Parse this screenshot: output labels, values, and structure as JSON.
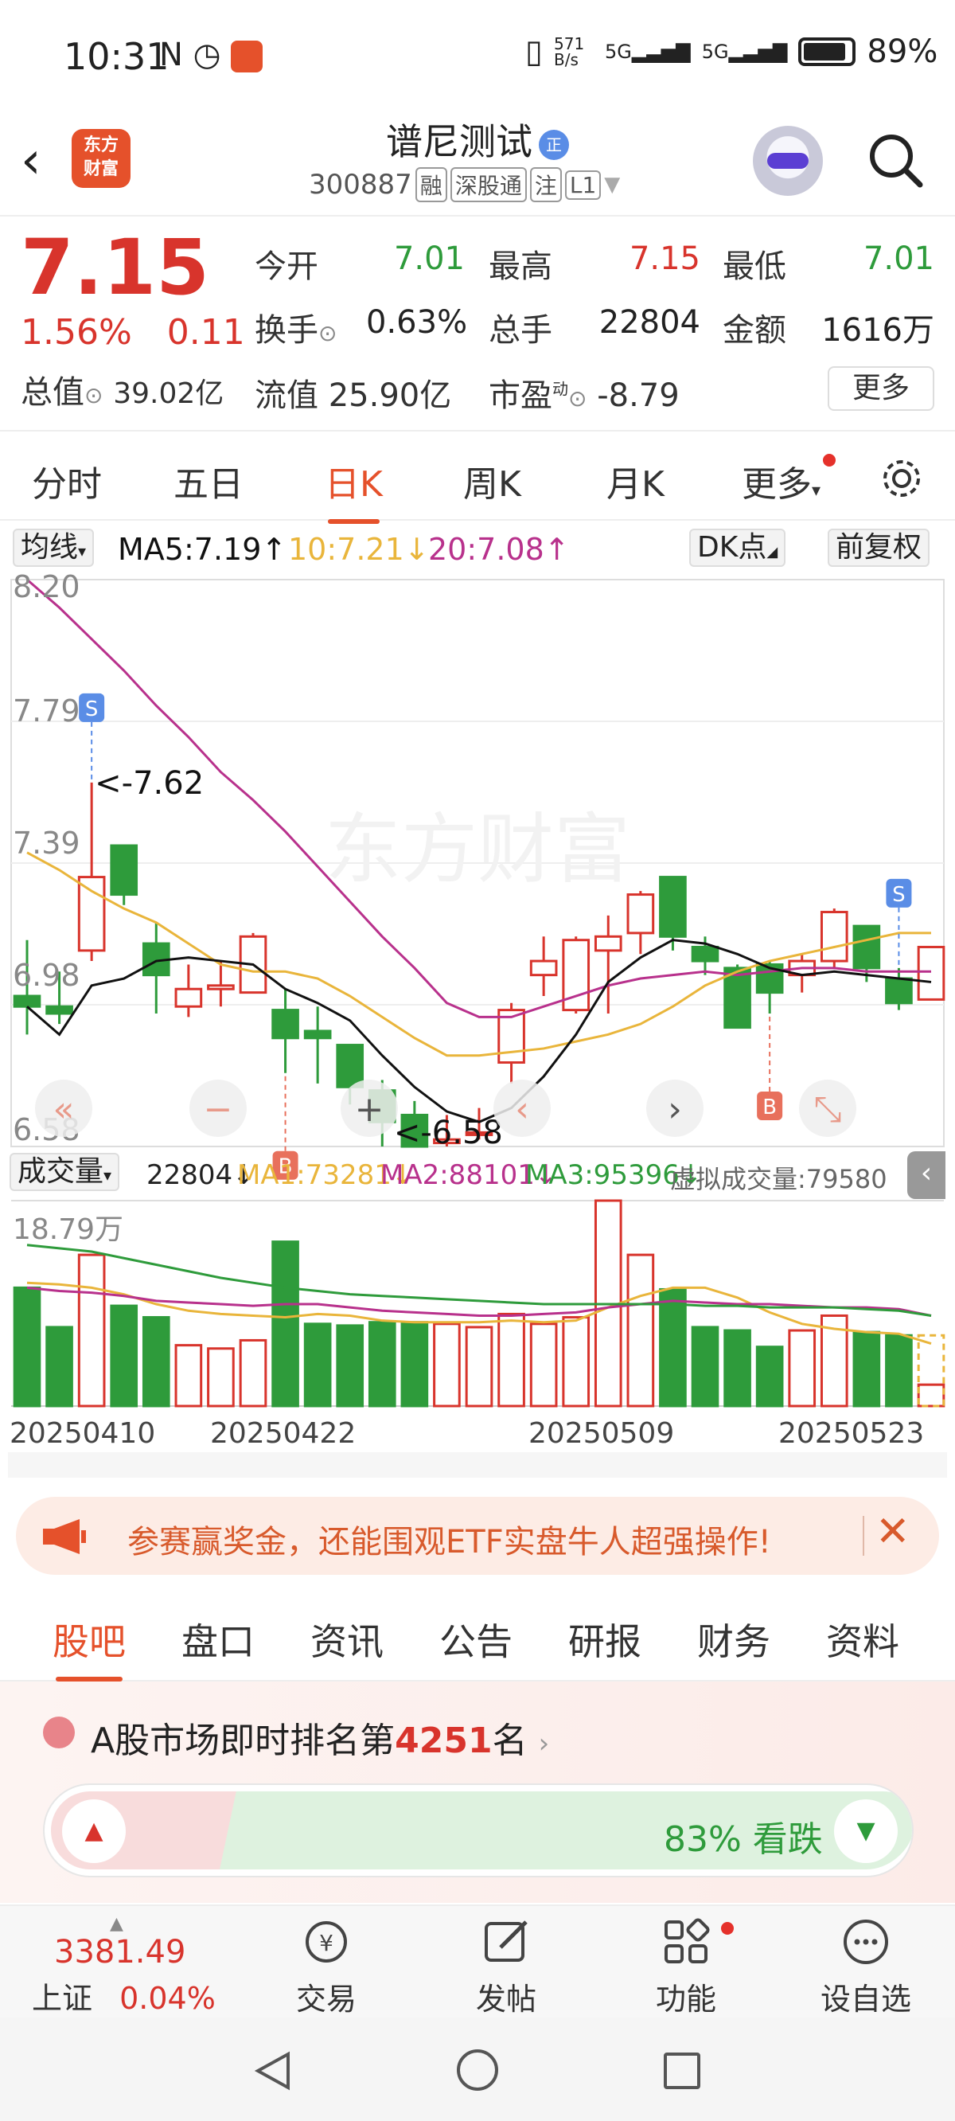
{
  "status_bar": {
    "time": "10:31",
    "speed": "571\nB/s",
    "net1": "5G",
    "net2": "5G",
    "battery": "89%"
  },
  "header": {
    "logo_text": "东方财富",
    "stock_name": "谱尼测试",
    "badge": "正",
    "code": "300887",
    "tags": [
      "融",
      "深股通",
      "注",
      "L1"
    ]
  },
  "quote": {
    "price": "7.15",
    "change_pct": "1.56%",
    "change_abs": "0.11",
    "market_cap_label": "总值",
    "market_cap": "39.02亿",
    "open_label": "今开",
    "open": "7.01",
    "high_label": "最高",
    "high": "7.15",
    "low_label": "最低",
    "low": "7.01",
    "turnover_label": "换手",
    "turnover": "0.63%",
    "volume_label": "总手",
    "volume": "22804",
    "amount_label": "金额",
    "amount": "1616万",
    "float_label": "流值",
    "float_cap": "25.90亿",
    "pe_label": "市盈",
    "pe_sup": "动",
    "pe": "-8.79",
    "more": "更多"
  },
  "tabs": [
    "分时",
    "五日",
    "日K",
    "周K",
    "月K",
    "更多"
  ],
  "active_tab": "日K",
  "ma_bar": {
    "indicator": "均线",
    "ma5": "MA5:7.19↑",
    "ma10": "10:7.21↓",
    "ma20": "20:7.08↑",
    "dk": "DK点",
    "adjust": "前复权"
  },
  "colors": {
    "up": "#d8342c",
    "down": "#2e9b3b",
    "ma5": "#111111",
    "ma10": "#e9b53b",
    "ma20": "#b8318c",
    "accent": "#e5512b"
  },
  "kline": {
    "y_ticks": [
      "8.20",
      "7.79",
      "7.39",
      "6.98",
      "6.58"
    ],
    "high_annot": "<-7.62",
    "low_annot": "<-6.58",
    "markers": {
      "sell": "S",
      "buy": "B"
    },
    "candles": [
      [
        7.01,
        6.98,
        7.17,
        6.9
      ],
      [
        6.98,
        6.96,
        7.08,
        6.93
      ],
      [
        7.14,
        7.35,
        7.62,
        7.11
      ],
      [
        7.44,
        7.3,
        7.44,
        7.27
      ],
      [
        7.16,
        7.07,
        7.22,
        6.96
      ],
      [
        6.98,
        7.03,
        7.1,
        6.95
      ],
      [
        7.03,
        7.04,
        7.11,
        6.98
      ],
      [
        7.02,
        7.18,
        7.19,
        7.02
      ],
      [
        6.97,
        6.89,
        7.03,
        6.79
      ],
      [
        6.91,
        6.89,
        6.98,
        6.76
      ],
      [
        6.87,
        6.75,
        6.87,
        6.7
      ],
      [
        6.74,
        6.65,
        6.77,
        6.58
      ],
      [
        6.67,
        6.58,
        6.71,
        6.58
      ],
      [
        6.59,
        6.6,
        6.67,
        6.58
      ],
      [
        6.62,
        6.62,
        6.69,
        6.6
      ],
      [
        6.82,
        6.97,
        6.99,
        6.76
      ],
      [
        7.07,
        7.11,
        7.18,
        7.01
      ],
      [
        6.97,
        7.17,
        7.18,
        6.96
      ],
      [
        7.14,
        7.18,
        7.24,
        6.96
      ],
      [
        7.19,
        7.3,
        7.31,
        7.13
      ],
      [
        7.35,
        7.18,
        7.35,
        7.14
      ],
      [
        7.15,
        7.11,
        7.18,
        7.07
      ],
      [
        7.09,
        6.92,
        7.1,
        7.01
      ],
      [
        7.1,
        7.02,
        7.11,
        6.96
      ],
      [
        7.07,
        7.11,
        7.13,
        7.02
      ],
      [
        7.11,
        7.25,
        7.26,
        7.09
      ],
      [
        7.21,
        7.09,
        7.21,
        7.05
      ],
      [
        7.06,
        6.99,
        7.09,
        6.97
      ],
      [
        7.0,
        7.15,
        7.15,
        7.0
      ]
    ],
    "ma5": [
      6.98,
      6.9,
      7.04,
      7.06,
      7.11,
      7.12,
      7.11,
      7.1,
      7.03,
      6.99,
      6.94,
      6.84,
      6.75,
      6.68,
      6.65,
      6.69,
      6.78,
      6.9,
      7.05,
      7.12,
      7.17,
      7.16,
      7.13,
      7.09,
      7.07,
      7.08,
      7.07,
      7.06,
      7.05
    ],
    "ma10": [
      7.42,
      7.37,
      7.31,
      7.26,
      7.22,
      7.16,
      7.1,
      7.08,
      7.08,
      7.06,
      7.01,
      6.95,
      6.89,
      6.84,
      6.84,
      6.85,
      6.86,
      6.88,
      6.9,
      6.93,
      6.98,
      7.04,
      7.08,
      7.11,
      7.13,
      7.15,
      7.17,
      7.19,
      7.19
    ],
    "ma20": [
      8.2,
      8.12,
      8.03,
      7.94,
      7.84,
      7.75,
      7.65,
      7.57,
      7.48,
      7.38,
      7.28,
      7.18,
      7.09,
      6.99,
      6.95,
      6.95,
      6.98,
      7.01,
      7.04,
      7.06,
      7.07,
      7.08,
      7.07,
      7.08,
      7.09,
      7.09,
      7.08,
      7.08,
      7.08
    ],
    "sell_idx": [
      2,
      27
    ],
    "buy_idx": [
      8,
      23
    ]
  },
  "volume_bar": {
    "label": "成交量",
    "value": "22804↓",
    "ma1": "MA1:73281↓",
    "ma2": "MA2:88101↓",
    "ma3": "MA3:95396↓",
    "virtual": "虚拟成交量:79580",
    "max_label": "18.79万",
    "volumes": [
      0.72,
      0.48,
      0.92,
      0.61,
      0.54,
      0.37,
      0.35,
      0.4,
      1.0,
      0.5,
      0.49,
      0.51,
      0.51,
      0.5,
      0.48,
      0.56,
      0.5,
      0.54,
      1.25,
      0.92,
      0.71,
      0.48,
      0.46,
      0.36,
      0.46,
      0.55,
      0.45,
      0.43,
      0.13
    ],
    "virtual_volume": 0.43,
    "vma1": [
      0.75,
      0.74,
      0.72,
      0.68,
      0.62,
      0.58,
      0.56,
      0.55,
      0.54,
      0.56,
      0.55,
      0.52,
      0.51,
      0.51,
      0.51,
      0.52,
      0.51,
      0.52,
      0.6,
      0.67,
      0.72,
      0.72,
      0.66,
      0.57,
      0.5,
      0.47,
      0.45,
      0.44,
      0.38
    ],
    "vma2": [
      0.72,
      0.7,
      0.69,
      0.67,
      0.64,
      0.63,
      0.62,
      0.61,
      0.62,
      0.62,
      0.6,
      0.58,
      0.57,
      0.56,
      0.55,
      0.55,
      0.56,
      0.57,
      0.6,
      0.62,
      0.64,
      0.63,
      0.62,
      0.62,
      0.61,
      0.6,
      0.6,
      0.59,
      0.55
    ],
    "vma3": [
      0.98,
      0.96,
      0.94,
      0.9,
      0.86,
      0.82,
      0.78,
      0.75,
      0.72,
      0.7,
      0.68,
      0.67,
      0.66,
      0.65,
      0.64,
      0.63,
      0.62,
      0.62,
      0.62,
      0.62,
      0.62,
      0.61,
      0.61,
      0.6,
      0.6,
      0.6,
      0.59,
      0.58,
      0.55
    ],
    "dates": [
      "20250410",
      "20250422",
      "20250509",
      "20250523"
    ]
  },
  "promo": {
    "text": "参赛赢奖金，还能围观ETF实盘牛人超强操作!"
  },
  "feature_tabs": [
    "股吧",
    "盘口",
    "资讯",
    "公告",
    "研报",
    "财务",
    "资料"
  ],
  "active_feature_tab": "股吧",
  "rank": {
    "prefix": "A股市场即时排名第",
    "number": "4251",
    "suffix": "名",
    "vote_text": "83% 看跌",
    "bearish_pct": 83
  },
  "bottom_nav": {
    "index_value": "3381.49",
    "index_name": "上证",
    "index_change": "0.04%",
    "items": [
      "交易",
      "发帖",
      "功能",
      "设自选"
    ]
  }
}
